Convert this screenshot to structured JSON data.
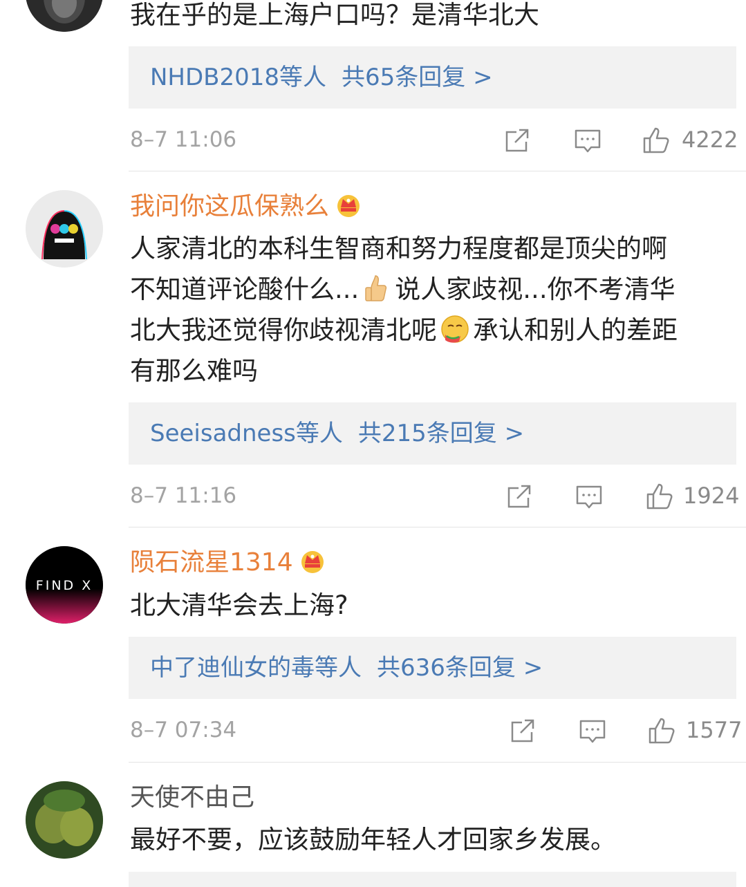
{
  "comments": [
    {
      "username": "",
      "text": "我在乎的是上海户口吗？是清华北大",
      "replies": {
        "users": "NHDB2018等人",
        "count": "共65条回复 >"
      },
      "time": "8–7 11:06",
      "likes": "4222"
    },
    {
      "username": "我问你这瓜保熟么",
      "text_parts": [
        "人家清北的本科生智商和努力程度都是顶尖的啊",
        "不知道评论酸什么...",
        "说人家歧视...你不考清华",
        "北大我还觉得你歧视清北呢",
        "承认和别人的差距",
        "有那么难吗"
      ],
      "emojis": [
        "thumbs-up-emoji",
        "thinking-melon-emoji"
      ],
      "replies": {
        "users": "Seeisadness等人",
        "count": "共215条回复 >"
      },
      "time": "8–7 11:16",
      "likes": "1924"
    },
    {
      "username": "陨石流星1314",
      "avatar_text": "FIND X",
      "text": "北大清华会去上海?",
      "replies": {
        "users": "中了迪仙女的毒等人",
        "count": "共636条回复 >"
      },
      "time": "8–7 07:34",
      "likes": "1577"
    },
    {
      "username": "天使不由己",
      "text": "最好不要，应该鼓励年轻人才回家乡发展。"
    }
  ],
  "colors": {
    "username": "#e8803a",
    "link": "#4a7ab4",
    "meta": "#a3a3a3",
    "text": "#222222",
    "reply_bg": "#f2f2f2"
  },
  "icons": [
    "share-icon",
    "comment-icon",
    "like-icon",
    "vip-crown-icon"
  ]
}
